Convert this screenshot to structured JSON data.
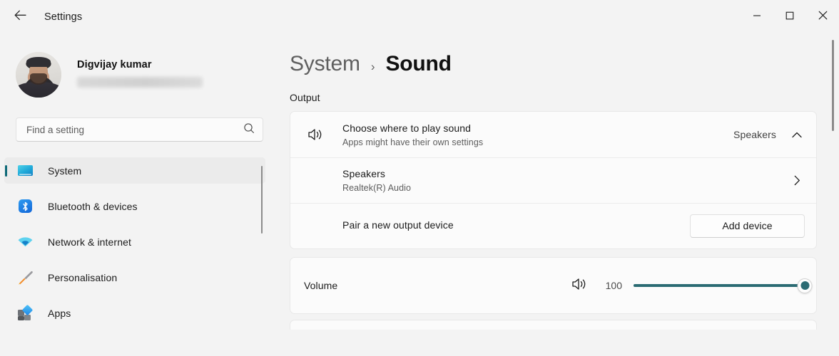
{
  "titlebar": {
    "back_icon": "arrow-left-icon",
    "app_title": "Settings",
    "minimize_label": "─",
    "maximize_label": "□",
    "close_label": "✕"
  },
  "sidebar": {
    "profile": {
      "name": "Digvijay kumar",
      "email_redacted": true,
      "avatar_icon": "user-avatar-photo"
    },
    "search": {
      "placeholder": "Find a setting",
      "value": "",
      "icon": "search-icon"
    },
    "items": [
      {
        "label": "System",
        "icon": "monitor-icon",
        "selected": true
      },
      {
        "label": "Bluetooth & devices",
        "icon": "bluetooth-icon",
        "selected": false
      },
      {
        "label": "Network & internet",
        "icon": "wifi-icon",
        "selected": false
      },
      {
        "label": "Personalisation",
        "icon": "paintbrush-icon",
        "selected": false
      },
      {
        "label": "Apps",
        "icon": "apps-icon",
        "selected": false
      }
    ],
    "accent_color": "#0f6a78"
  },
  "main": {
    "breadcrumb": {
      "parent": "System",
      "separator": "›",
      "current": "Sound"
    },
    "section_output": "Output",
    "output_card": {
      "choose_device": {
        "icon": "volume-speaker-icon",
        "title": "Choose where to play sound",
        "subtitle": "Apps might have their own settings",
        "value": "Speakers",
        "expander_icon": "chevron-up-icon",
        "expanded": true
      },
      "speakers_row": {
        "title": "Speakers",
        "subtitle": "Realtek(R) Audio",
        "chevron_icon": "chevron-right-icon"
      },
      "pair_row": {
        "title": "Pair a new output device",
        "button_label": "Add device"
      }
    },
    "volume_card": {
      "label": "Volume",
      "icon": "volume-speaker-icon",
      "value": "100",
      "slider": {
        "min": 0,
        "max": 100,
        "current": 100,
        "fill_color": "#2b6b73"
      }
    }
  }
}
